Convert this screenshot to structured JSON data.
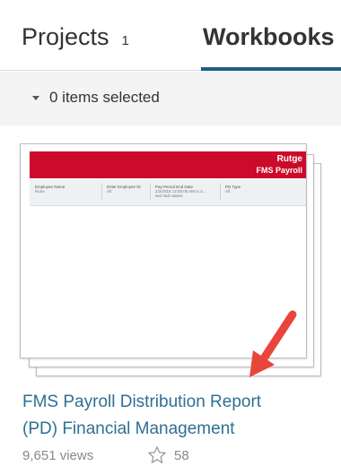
{
  "tabs": {
    "projects_label": "Projects",
    "projects_count": "1",
    "workbooks_label": "Workbooks",
    "accent_color": "#1f5f82"
  },
  "selection": {
    "text": "0 items selected"
  },
  "thumbnail": {
    "header_title": "Rutge",
    "header_subtitle": "FMS Payroll",
    "header_color": "#cc0a2b",
    "filters": [
      {
        "label": "Employee Name",
        "value": "None"
      },
      {
        "label": "Enter Employee ID",
        "value": "All"
      },
      {
        "label": "Pay Period End Date",
        "value": "2/2/2018 12:00:00 AM to 2..."
      },
      {
        "label": "PD Type",
        "value": "All"
      }
    ]
  },
  "workbook": {
    "title_line1": "FMS Payroll Distribution Report",
    "title_line2": "(PD) Financial Management",
    "views": "9,651 views",
    "favorites": "58"
  }
}
